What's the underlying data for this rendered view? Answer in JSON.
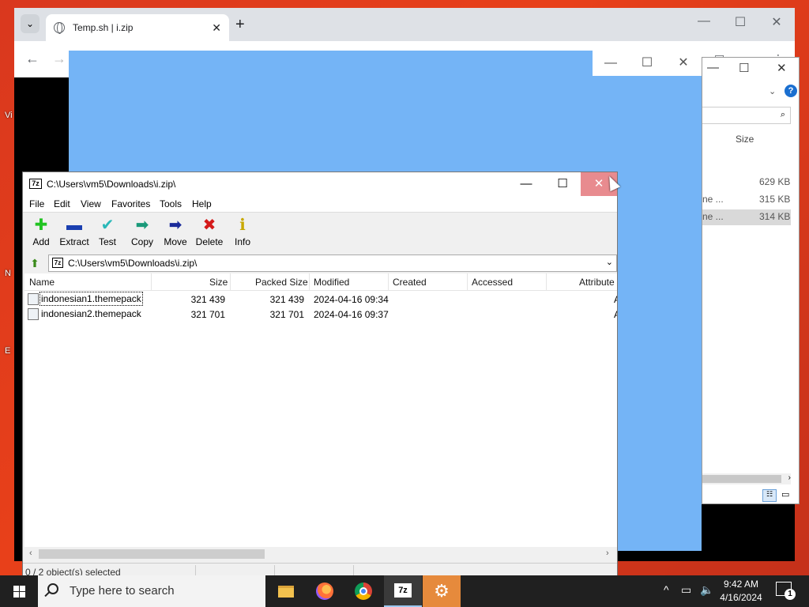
{
  "desktop": {
    "fragments": [
      "Vi",
      "N",
      "E"
    ]
  },
  "chrome": {
    "tab_title": "Temp.sh | i.zip",
    "tab_close": "✕",
    "new_tab": "+",
    "minimize": "—",
    "maximize": "☐",
    "close": "✕",
    "back": "←",
    "forward": "→"
  },
  "blue_window": {
    "minimize": "—",
    "maximize": "☐",
    "close": "✕"
  },
  "explorer": {
    "minimize": "—",
    "maximize": "☐",
    "close": "✕",
    "column_size": "Size",
    "rows": [
      {
        "name": "",
        "size": "629 KB"
      },
      {
        "name": "ne ...",
        "size": "315 KB"
      },
      {
        "name": "ne ...",
        "size": "314 KB"
      }
    ]
  },
  "zip": {
    "title": "C:\\Users\\vm5\\Downloads\\i.zip\\",
    "app_icon": "7z",
    "minimize": "—",
    "maximize": "☐",
    "close": "✕",
    "menu": [
      "File",
      "Edit",
      "View",
      "Favorites",
      "Tools",
      "Help"
    ],
    "toolbar": [
      {
        "label": "Add",
        "icon": "plus-icon",
        "color": "#22c422",
        "glyph": "✚"
      },
      {
        "label": "Extract",
        "icon": "minus-icon",
        "color": "#1a3fb0",
        "glyph": "▬"
      },
      {
        "label": "Test",
        "icon": "check-icon",
        "color": "#2ab8b8",
        "glyph": "✔"
      },
      {
        "label": "Copy",
        "icon": "copy-arrow-icon",
        "color": "#1a9a7a",
        "glyph": "➡"
      },
      {
        "label": "Move",
        "icon": "move-arrow-icon",
        "color": "#1a2a9a",
        "glyph": "➡"
      },
      {
        "label": "Delete",
        "icon": "delete-x-icon",
        "color": "#d41a1a",
        "glyph": "✖"
      },
      {
        "label": "Info",
        "icon": "info-icon",
        "color": "#c8a800",
        "glyph": "ℹ"
      }
    ],
    "address": "C:\\Users\\vm5\\Downloads\\i.zip\\",
    "columns": [
      "Name",
      "Size",
      "Packed Size",
      "Modified",
      "Created",
      "Accessed",
      "Attribute"
    ],
    "files": [
      {
        "name": "indonesian1.themepack",
        "size": "321 439",
        "packed": "321 439",
        "modified": "2024-04-16 09:34",
        "created": "",
        "accessed": "",
        "attr": "A"
      },
      {
        "name": "indonesian2.themepack",
        "size": "321 701",
        "packed": "321 701",
        "modified": "2024-04-16 09:37",
        "created": "",
        "accessed": "",
        "attr": "A"
      }
    ],
    "status": "0 / 2 object(s) selected"
  },
  "taskbar": {
    "search_placeholder": "Type here to search",
    "zip_label": "7z",
    "time": "9:42 AM",
    "date": "4/16/2024",
    "notifications": "1"
  }
}
